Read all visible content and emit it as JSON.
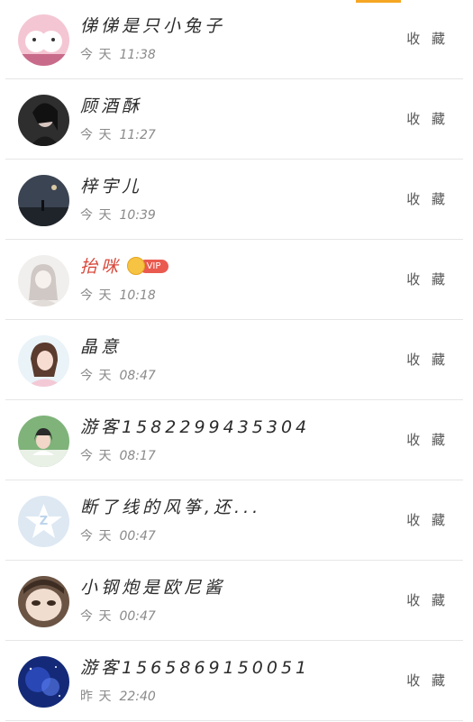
{
  "collect_label": "收 藏",
  "today_label": "今 天",
  "rows": [
    {
      "name": "俤俤是只小兔子",
      "day": "今 天",
      "time": "11:38",
      "vip": false
    },
    {
      "name": "顾酒酥",
      "day": "今 天",
      "time": "11:27",
      "vip": false
    },
    {
      "name": "梓宇儿",
      "day": "今 天",
      "time": "10:39",
      "vip": false
    },
    {
      "name": "抬咪",
      "day": "今 天",
      "time": "10:18",
      "vip": true,
      "vip_label": "VIP"
    },
    {
      "name": "晶意",
      "day": "今 天",
      "time": "08:47",
      "vip": false
    },
    {
      "name": "游客1582299435304",
      "day": "今 天",
      "time": "08:17",
      "vip": false
    },
    {
      "name": "断了线的风筝,还...",
      "day": "今 天",
      "time": "00:47",
      "vip": false
    },
    {
      "name": "小钢炮是欧尼酱",
      "day": "今 天",
      "time": "00:47",
      "vip": false
    },
    {
      "name": "游客1565869150051",
      "day": "昨 天",
      "time": "22:40",
      "vip": false
    }
  ],
  "colors": {
    "accent": "#f5a623",
    "vip_name": "#d9483b",
    "vip_pill": "#ea5a4f"
  },
  "icons": {
    "crown": "crown-icon",
    "default_avatar": "qq-star-icon"
  }
}
